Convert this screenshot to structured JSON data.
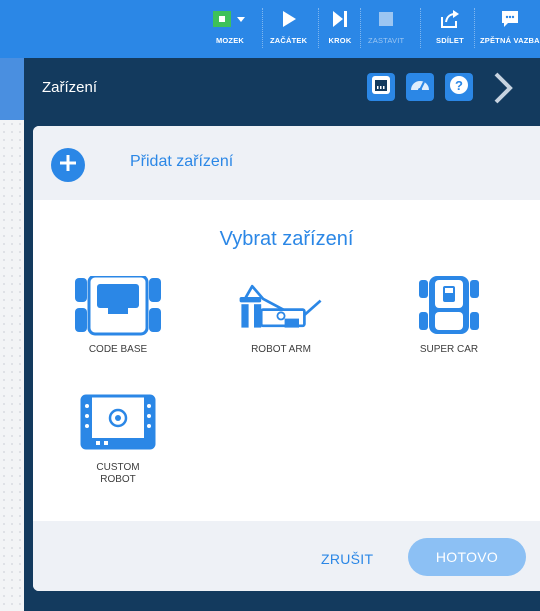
{
  "toolbar": {
    "items": [
      {
        "label": "MOZEK",
        "icon": "brain-block-icon"
      },
      {
        "label": "ZAČÁTEK",
        "icon": "play-icon"
      },
      {
        "label": "KROK",
        "icon": "step-icon"
      },
      {
        "label": "ZASTAVIT",
        "icon": "stop-icon"
      },
      {
        "label": "SDÍLET",
        "icon": "share-icon"
      },
      {
        "label": "ZPĚTNÁ VAZBA",
        "icon": "feedback-icon"
      }
    ]
  },
  "panel": {
    "title": "Zařízení"
  },
  "dialog": {
    "add_label": "Přidat zařízení",
    "title": "Vybrat zařízení",
    "devices": [
      {
        "label": "CODE BASE",
        "icon": "code-base-icon"
      },
      {
        "label": "ROBOT ARM",
        "icon": "robot-arm-icon"
      },
      {
        "label": "SUPER CAR",
        "icon": "super-car-icon"
      },
      {
        "label": "CUSTOM\nROBOT",
        "icon": "custom-robot-icon"
      }
    ],
    "cancel_label": "ZRUŠIT",
    "done_label": "HOTOVO"
  },
  "colors": {
    "toolbar": "#2b87e6",
    "panel": "#133a5e",
    "accent": "#2b87e6",
    "disabled_button": "#8cc0f4",
    "brain_green": "#3ec15a"
  }
}
